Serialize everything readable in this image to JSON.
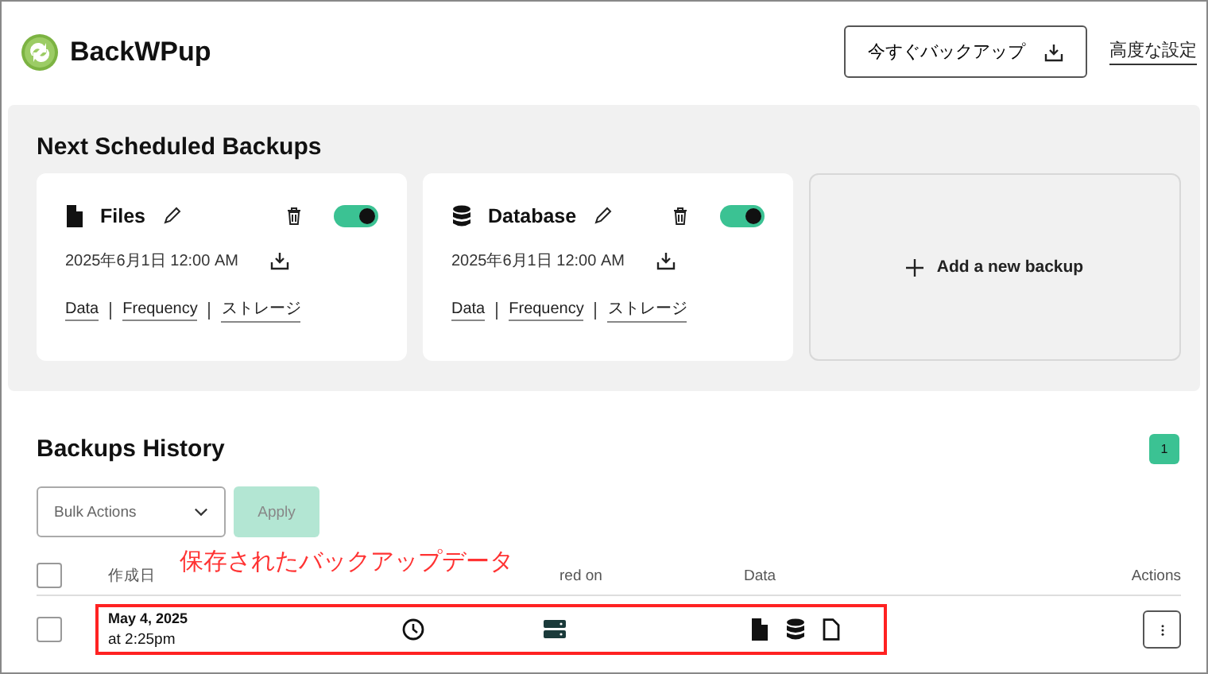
{
  "header": {
    "logo": "BackWPup",
    "backup_now_button": "今すぐバックアップ",
    "advanced_settings_link": "高度な設定"
  },
  "scheduled": {
    "title": "Next Scheduled Backups",
    "cards": [
      {
        "kind": "files",
        "name": "Files",
        "enabled": true,
        "date": "2025年6月1日 12:00 AM",
        "links": [
          "Data",
          "Frequency",
          "ストレージ"
        ]
      },
      {
        "kind": "database",
        "name": "Database",
        "enabled": true,
        "date": "2025年6月1日 12:00 AM",
        "links": [
          "Data",
          "Frequency",
          "ストレージ"
        ]
      }
    ],
    "add_button": "Add a new backup"
  },
  "history": {
    "title": "Backups History",
    "count": "1",
    "bulk_actions": {
      "placeholder": "Bulk Actions"
    },
    "apply_button": {
      "label": "Apply",
      "disabled": true
    },
    "select_all_checked": false,
    "columns": [
      "作成日",
      "red on",
      "Data",
      "Actions"
    ],
    "rows": [
      {
        "checked": false,
        "date": "May 4, 2025",
        "time": "at 2:25pm",
        "data": [
          {
            "kind": "files"
          },
          {
            "kind": "database"
          },
          {
            "kind": "log"
          }
        ]
      }
    ]
  },
  "annotation": {
    "text": "保存されたバックアップデータ"
  }
}
